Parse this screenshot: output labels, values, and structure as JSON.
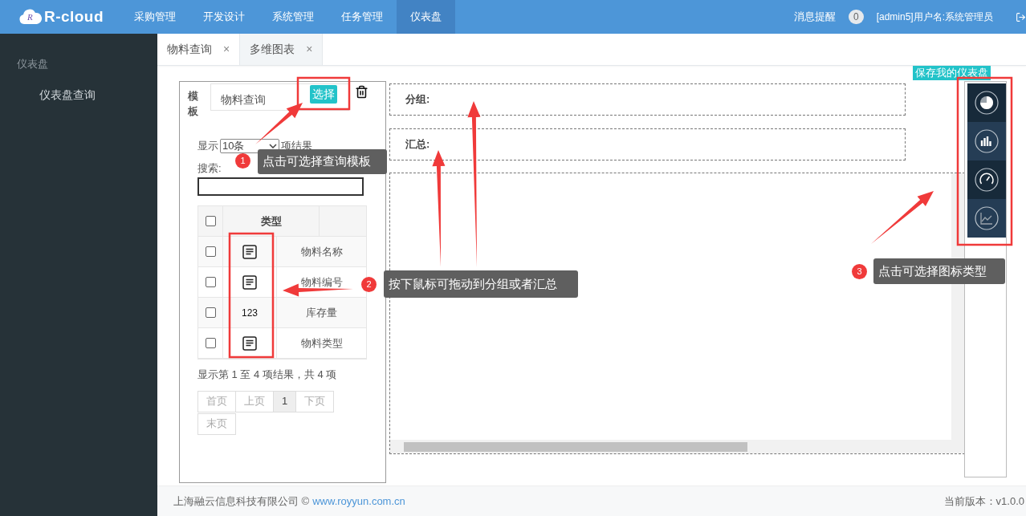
{
  "header": {
    "logo": {
      "mark": "R",
      "text": "R-cloud"
    },
    "nav": [
      {
        "label": "采购管理",
        "selected": false
      },
      {
        "label": "开发设计",
        "selected": false
      },
      {
        "label": "系统管理",
        "selected": false
      },
      {
        "label": "任务管理",
        "selected": false
      },
      {
        "label": "仪表盘",
        "selected": true
      }
    ],
    "notice_label": "消息提醒",
    "notice_count": "0",
    "user": "[admin5]用户名:系统管理员"
  },
  "sidebar": {
    "section": "仪表盘",
    "items": [
      {
        "label": "仪表盘查询"
      }
    ]
  },
  "tabs": [
    {
      "label": "物料查询",
      "close": "×",
      "selected": false
    },
    {
      "label": "多维图表",
      "close": "×",
      "selected": true
    }
  ],
  "template": {
    "label_lines": [
      "模",
      "板"
    ],
    "value": "物料查询",
    "select_button": "选择"
  },
  "table_controls": {
    "show_prefix": "显示",
    "page_size": "10条",
    "show_suffix": "项结果",
    "search_label": "搜索:"
  },
  "table": {
    "columns": [
      "类型"
    ],
    "rows": [
      {
        "checked": false,
        "kind": "text",
        "name": "物料名称"
      },
      {
        "checked": false,
        "kind": "text",
        "name": "物料编号"
      },
      {
        "checked": false,
        "kind": "number",
        "type_label": "123",
        "name": "库存量"
      },
      {
        "checked": false,
        "kind": "text",
        "name": "物料类型"
      }
    ],
    "header_checked": false
  },
  "table_info": "显示第 1 至 4 项结果，共 4 项",
  "pagination": [
    {
      "label": "首页",
      "selected": false,
      "disabled": true
    },
    {
      "label": "上页",
      "selected": false,
      "disabled": true
    },
    {
      "label": "1",
      "selected": true,
      "disabled": false
    },
    {
      "label": "下页",
      "selected": false,
      "disabled": true
    },
    {
      "label": "末页",
      "selected": false,
      "disabled": true
    }
  ],
  "drop_zones": [
    {
      "label": "分组:"
    },
    {
      "label": "汇总:"
    }
  ],
  "save_button": "保存我的仪表盘",
  "chart_types": [
    {
      "kind": "pie"
    },
    {
      "kind": "bar"
    },
    {
      "kind": "gauge"
    },
    {
      "kind": "line"
    }
  ],
  "annotations": [
    {
      "number": "1",
      "text": "点击可选择查询模板"
    },
    {
      "number": "2",
      "text": "按下鼠标可拖动到分组或者汇总"
    },
    {
      "number": "3",
      "text": "点击可选择图标类型"
    }
  ],
  "footer": {
    "company": "上海融云信息科技有限公司 ©",
    "link": "www.royyun.com.cn",
    "version": "当前版本：v1.0.0"
  }
}
